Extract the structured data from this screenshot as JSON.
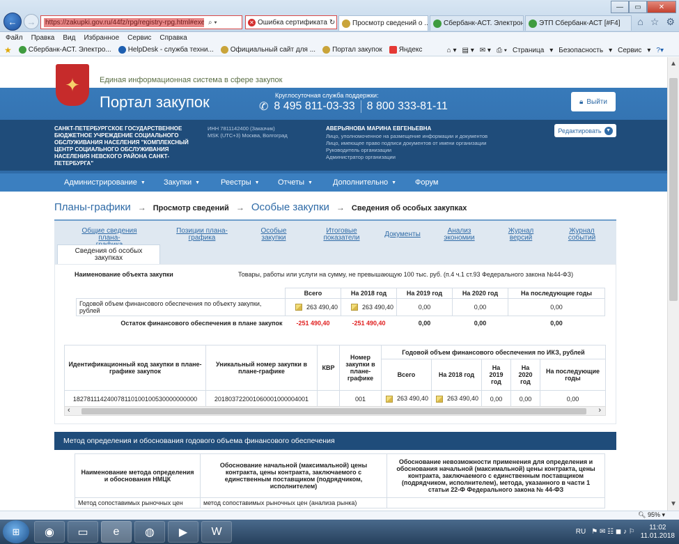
{
  "browser": {
    "url": "https://zakupki.gov.ru/44fz/rpg/registry-rpg.html#executions?",
    "cert_error": "Ошибка сертификата",
    "tabs": [
      {
        "label": "Просмотр сведений о ...",
        "active": true
      },
      {
        "label": "Сбербанк-АСТ. Электрон...",
        "active": false
      },
      {
        "label": "ЭТП Сбербанк-АСТ [#F4]",
        "active": false
      }
    ],
    "menu": [
      "Файл",
      "Правка",
      "Вид",
      "Избранное",
      "Сервис",
      "Справка"
    ],
    "favorites": [
      "Сбербанк-АСТ. Электро...",
      "HelpDesk - служба техни...",
      "Официальный сайт для ...",
      "Портал закупок",
      "Яндекс"
    ],
    "toolbar_right": [
      "Страница",
      "Безопасность",
      "Сервис"
    ]
  },
  "site": {
    "eis_title": "Единая информационная система в сфере закупок",
    "portal_title": "Портал закупок",
    "support_label": "Круглосуточная служба поддержки:",
    "phone1": "8 495 811-03-33",
    "phone2": "8 800 333-81-11",
    "exit_label": "Выйти",
    "org_name": "САНКТ-ПЕТЕРБУРГСКОЕ ГОСУДАРСТВЕННОЕ БЮДЖЕТНОЕ УЧРЕЖДЕНИЕ СОЦИАЛЬНОГО ОБСЛУЖИВАНИЯ НАСЕЛЕНИЯ \"КОМПЛЕКСНЫЙ ЦЕНТР СОЦИАЛЬНОГО ОБСЛУЖИВАНИЯ НАСЕЛЕНИЯ НЕВСКОГО РАЙОНА САНКТ-ПЕТЕРБУРГА\"",
    "org_inn": "ИНН 7811142400 (Заказчик)",
    "org_tz": "MSK (UTC+3) Москва, Волгоград",
    "user_name": "АВЕРЬЯНОВА МАРИНА ЕВГЕНЬЕВНА",
    "user_roles": [
      "Лицо, уполномоченное на размещение информации и документов",
      "Лицо, имеющее право подписи документов от имени организации",
      "Руководитель организации",
      "Администратор организации"
    ],
    "edit_label": "Редактировать",
    "nav": [
      "Администрирование",
      "Закупки",
      "Реестры",
      "Отчеты",
      "Дополнительно",
      "Форум"
    ]
  },
  "breadcrumbs": {
    "b1": "Планы-графики",
    "b2": "Просмотр сведений",
    "b3": "Особые закупки",
    "b4": "Сведения об особых закупках"
  },
  "tabs": {
    "links": [
      [
        "Общие сведения плана-",
        "графика"
      ],
      [
        "Позиции плана-",
        "графика"
      ],
      [
        "Особые",
        "закупки"
      ],
      [
        "Итоговые",
        "показатели"
      ],
      [
        "Документы",
        ""
      ],
      [
        "Анализ",
        "экономии"
      ],
      [
        "Журнал",
        "версий"
      ],
      [
        "Журнал",
        "событий"
      ]
    ],
    "active": [
      "Сведения об особых",
      "закупках"
    ]
  },
  "object": {
    "label": "Наименование объекта закупки",
    "value": "Товары, работы или услуги на сумму, не превышающую 100 тыс. руб. (п.4 ч.1 ст.93 Федерального закона №44-ФЗ)"
  },
  "finance_table": {
    "headers": [
      "Всего",
      "На 2018 год",
      "На 2019 год",
      "На 2020 год",
      "На последующие годы"
    ],
    "row1_label": "Годовой объем финансового обеспечения по объекту закупки, рублей",
    "row1": [
      "263 490,40",
      "263 490,40",
      "0,00",
      "0,00",
      "0,00"
    ],
    "row2_label": "Остаток финансового обеспечения в плане закупок",
    "row2": [
      "-251 490,40",
      "-251 490,40",
      "0,00",
      "0,00",
      "0,00"
    ]
  },
  "ikz_table": {
    "h_ikz": "Идентификационный код закупки в плане-графике закупок",
    "h_unique": "Уникальный номер закупки в плане-графике",
    "h_kvr": "КВР",
    "h_num": "Номер закупки в плане-графике",
    "h_group": "Годовой объем финансового обеспечения по ИКЗ, рублей",
    "h_sub": [
      "Всего",
      "На 2018 год",
      "На 2019 год",
      "На 2020 год",
      "На последующие годы"
    ],
    "row": {
      "ikz": "182781114240078110100100530000000000",
      "unique": "201803722001060001000004001",
      "kvr": "",
      "num": "001",
      "vals": [
        "263 490,40",
        "263 490,40",
        "0,00",
        "0,00",
        "0,00"
      ]
    }
  },
  "method_section": {
    "title": "Метод определения и обоснования годового объема финансового обеспечения",
    "h1": "Наименование метода определения и обоснования НМЦК",
    "h2": "Обоснование начальной (максимальной) цены контракта, цены контракта, заключаемого с единственным поставщиком (подрядчиком, исполнителем)",
    "h3": "Обоснование невозможности применения для определения и обоснования начальной (максимальной) цены контракта, цены контракта, заключаемого с единственным поставщиком (подрядчиком, исполнителем), метода, указанного в части 1 статьи 22-Ф Федерального закона № 44-ФЗ",
    "row_method": "Метод сопоставимых рыночных цен",
    "row_basis": "метод сопоставимых рыночных цен (анализа рынка)"
  },
  "status": {
    "zoom": "95%"
  },
  "taskbar": {
    "lang": "RU",
    "time": "11:02",
    "date": "11.01.2018"
  }
}
